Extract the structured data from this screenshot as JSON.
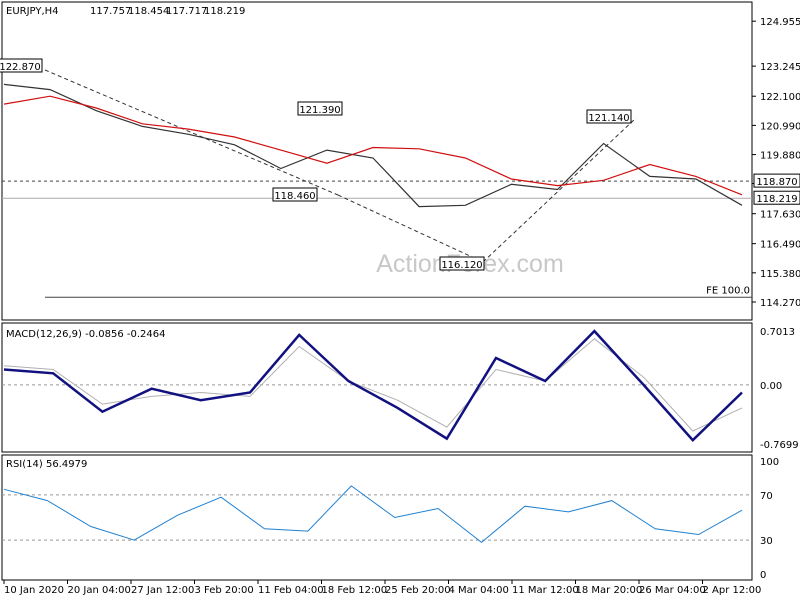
{
  "chart_data": [
    {
      "type": "line",
      "title": "EURJPY,H4",
      "header_values": [
        "117.757",
        "118.454",
        "117.717",
        "118.219"
      ],
      "watermark": "ActionForex.com",
      "ylim": [
        114.27,
        125.0
      ],
      "y_ticks": [
        "124.955",
        "123.245",
        "122.100",
        "120.990",
        "119.880",
        "118.780",
        "117.630",
        "116.490",
        "115.380",
        "114.270"
      ],
      "x": [
        "10 Jan 2020",
        "20 Jan 04:00",
        "27 Jan 12:00",
        "3 Feb 20:00",
        "11 Feb 04:00",
        "18 Feb 12:00",
        "25 Feb 20:00",
        "4 Mar 04:00",
        "11 Mar 12:00",
        "18 Mar 20:00",
        "26 Mar 04:00",
        "2 Apr 12:00"
      ],
      "series": [
        {
          "values": [
            122.55,
            122.35,
            121.55,
            120.95,
            120.65,
            120.25,
            119.35,
            120.05,
            119.75,
            117.9,
            117.95,
            118.75,
            118.55,
            120.3,
            119.05,
            118.95,
            117.95
          ]
        },
        {
          "values": [
            121.8,
            122.1,
            121.65,
            121.05,
            120.85,
            120.55,
            120.05,
            119.55,
            120.15,
            120.1,
            119.75,
            118.95,
            118.7,
            118.9,
            119.5,
            119.05,
            118.35
          ]
        }
      ],
      "levels": [
        {
          "label": "118.870",
          "value": 118.87
        },
        {
          "label": "118.219",
          "value": 118.219
        },
        {
          "label": "FE 100.0",
          "value": 114.45
        }
      ],
      "annotations": [
        "122.870",
        "121.390",
        "118.460",
        "116.120",
        "121.140"
      ]
    },
    {
      "type": "line",
      "title": "MACD(12,26,9) -0.0856 -0.2464",
      "ylim": [
        -0.7699,
        0.7013
      ],
      "y_ticks": [
        "0.7013",
        "0.00",
        "-0.7699"
      ],
      "series": [
        {
          "values": [
            0.2,
            0.15,
            -0.35,
            -0.05,
            -0.2,
            -0.1,
            0.65,
            0.05,
            -0.3,
            -0.7,
            0.35,
            0.05,
            0.7,
            0.0,
            -0.72,
            -0.1
          ]
        },
        {
          "values": [
            0.25,
            0.2,
            -0.25,
            -0.15,
            -0.1,
            -0.15,
            0.5,
            0.05,
            -0.2,
            -0.55,
            0.2,
            0.05,
            0.6,
            0.1,
            -0.6,
            -0.3
          ]
        }
      ]
    },
    {
      "type": "line",
      "title": "RSI(14) 56.4979",
      "ylim": [
        0,
        100
      ],
      "y_ticks": [
        "100",
        "70",
        "30",
        "0"
      ],
      "series": [
        {
          "values": [
            75,
            65,
            42,
            30,
            52,
            68,
            40,
            38,
            78,
            50,
            58,
            28,
            60,
            55,
            65,
            40,
            35,
            56.5
          ]
        }
      ]
    }
  ]
}
